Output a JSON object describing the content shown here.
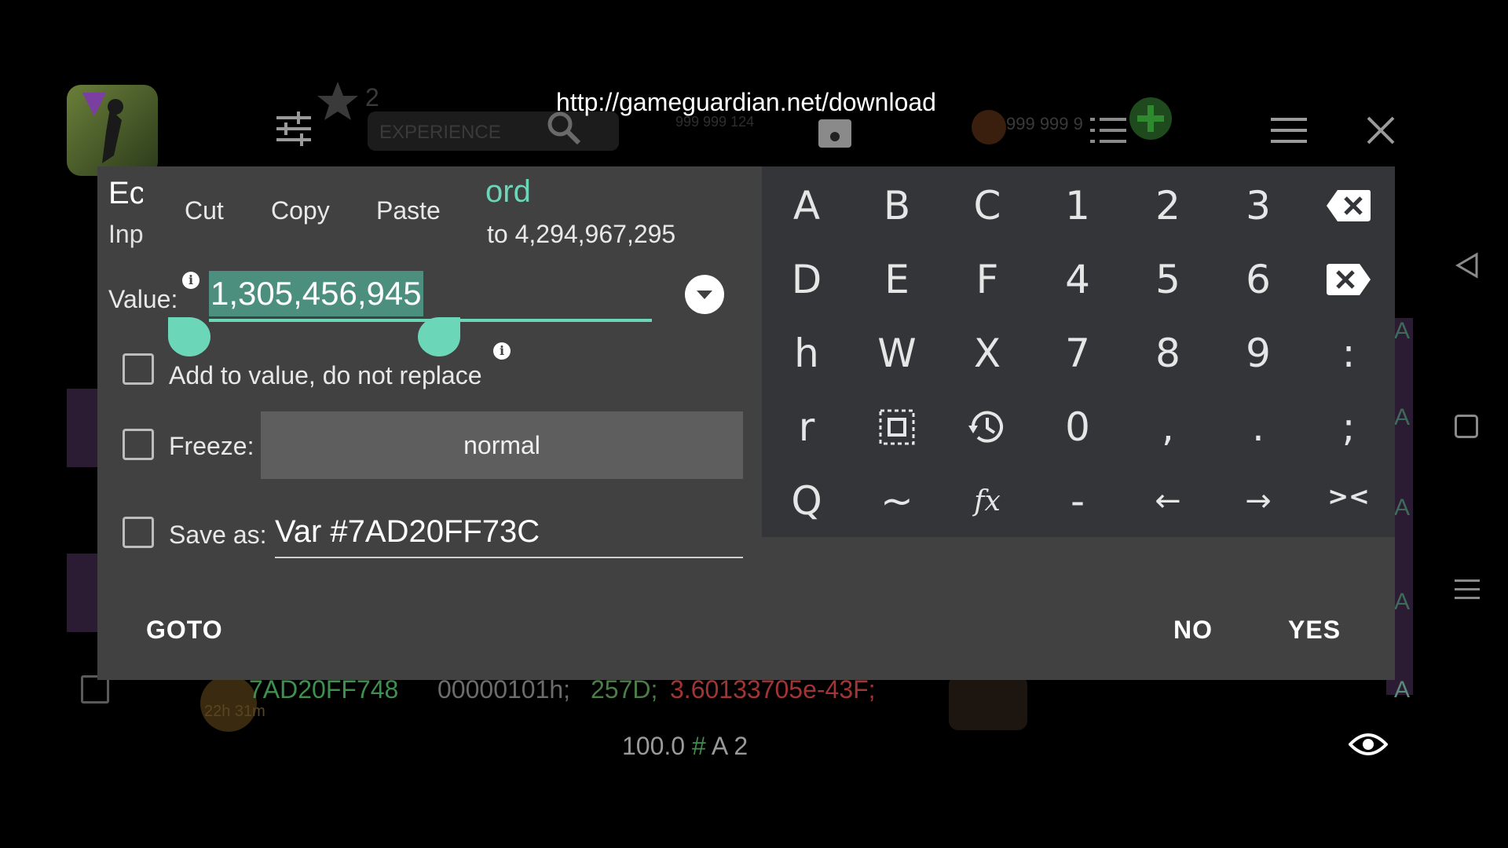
{
  "top_bar": {
    "url": "http://gameguardian.net/download",
    "icons": [
      "app-logo-icon",
      "sliders-icon",
      "search-icon",
      "save-icon",
      "list-icon",
      "menu-icon",
      "close-icon"
    ]
  },
  "background": {
    "xp_label": "EXPERIENCE",
    "star_count": "2",
    "coins_left": "999 999 124",
    "coins_right": "999 999 9",
    "result_row": {
      "address": "7AD20FF748",
      "hex": "00000101h;",
      "dec": "257D;",
      "float": "3.60133705e-43F;",
      "type": "A",
      "timer": "22h 31m"
    },
    "status": {
      "speed": "100.0",
      "hash": "#",
      "type": "A",
      "count": "2"
    },
    "row_types": [
      "A",
      "A",
      "A",
      "A"
    ]
  },
  "dialog": {
    "title_partial": "Ec",
    "subtitle_partial": "Inp",
    "word_partial": "ord",
    "range_partial": "to 4,294,967,295",
    "context_menu": [
      "Cut",
      "Copy",
      "Paste"
    ],
    "value_label": "Value:",
    "value": "1,305,456,945",
    "add_to_value_label": "Add to value, do not replace",
    "freeze_label": "Freeze:",
    "freeze_mode": "normal",
    "save_as_label": "Save as:",
    "save_as_value": "Var #7AD20FF73C",
    "goto_label": "GOTO",
    "no_label": "NO",
    "yes_label": "YES"
  },
  "keyboard": {
    "rows": [
      [
        "A",
        "B",
        "C",
        "1",
        "2",
        "3"
      ],
      [
        "D",
        "E",
        "F",
        "4",
        "5",
        "6"
      ],
      [
        "h",
        "W",
        "X",
        "7",
        "8",
        "9",
        ":"
      ],
      [
        "r",
        "",
        "",
        "0",
        ",",
        ".",
        ";"
      ],
      [
        "Q",
        "~",
        "fx",
        "-",
        "←",
        "→",
        "><"
      ]
    ]
  },
  "colors": {
    "accent": "#6cd6b8",
    "dialog_bg": "#414141",
    "keyboard_bg": "#333538",
    "address_green": "#3f8f4e",
    "float_red": "#a03535"
  }
}
